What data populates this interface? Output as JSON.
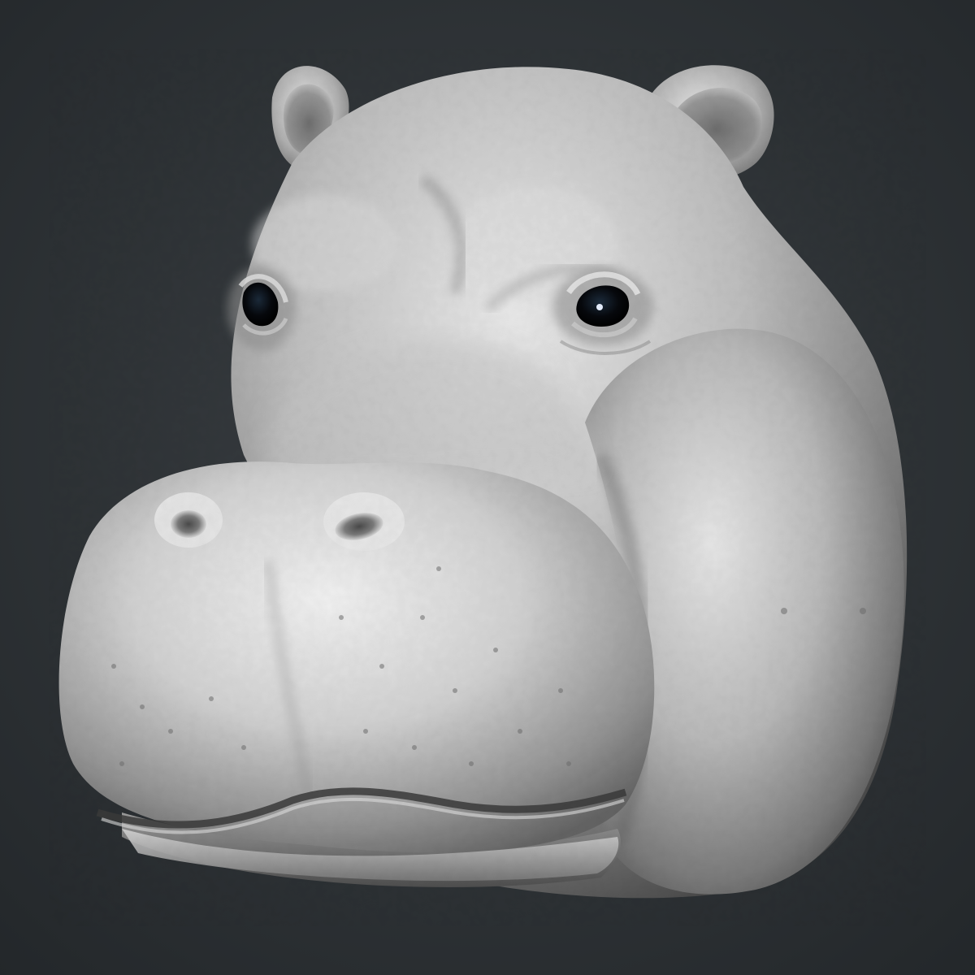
{
  "scene": {
    "subject": "hippopotamus-head-sculpt",
    "render_style": "clay-matcap",
    "colors": {
      "background_top": "#3a3f43",
      "background_bottom": "#23272a",
      "clay_light": "#f2f2f2",
      "clay_mid": "#a9a9a9",
      "clay_dark": "#3c3c3c",
      "eye": "#06080c"
    }
  }
}
